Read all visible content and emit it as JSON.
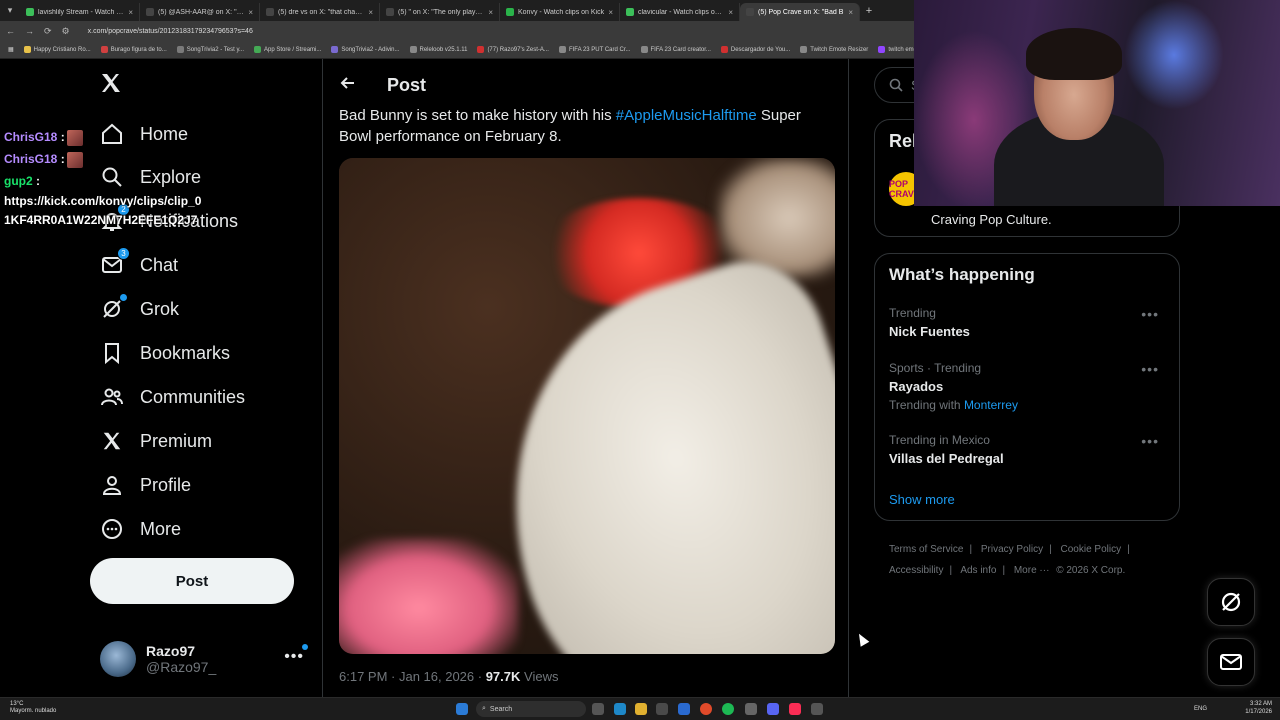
{
  "browser": {
    "tabs": [
      {
        "title": "lavishlily Stream - Watch Live o",
        "color": "#3cbf5a",
        "active": false
      },
      {
        "title": "(5) @ASH-AAR@ on X: \"Demo",
        "color": "#444444",
        "active": false
      },
      {
        "title": "(5) dre vs on X: \"that charlie ki",
        "color": "#444444",
        "active": false
      },
      {
        "title": "(5) \" on X: \"The only player to",
        "color": "#444444",
        "active": false
      },
      {
        "title": "Konvy - Watch clips on Kick",
        "color": "#2ab34a",
        "active": false
      },
      {
        "title": "clavicular - Watch clips on Kick",
        "color": "#3cbf5a",
        "active": false
      },
      {
        "title": "(5) Pop Crave on X: \"Bad B",
        "color": "#444444",
        "active": true
      }
    ],
    "url": "x.com/popcrave/status/2012318317923479653?s=46",
    "bookmarks": [
      {
        "label": "Happy Cristiano Ro...",
        "color": "#e8c24a"
      },
      {
        "label": "Burago figura de to...",
        "color": "#d04040"
      },
      {
        "label": "SongTrivia2 - Test y...",
        "color": "#7a7a7a"
      },
      {
        "label": "App Store / Streami...",
        "color": "#44aa55"
      },
      {
        "label": "SongTrivia2 - Adivin...",
        "color": "#7a6ad0"
      },
      {
        "label": "Releloob v25.1.11",
        "color": "#888888"
      },
      {
        "label": "(77) Razo97's Zest-A...",
        "color": "#d03030"
      },
      {
        "label": "FIFA 23 PUT Card Cr...",
        "color": "#888888"
      },
      {
        "label": "FIFA 23 Card creator...",
        "color": "#888888"
      },
      {
        "label": "Descargador de You...",
        "color": "#d03030"
      },
      {
        "label": "Twitch Emote Resizer",
        "color": "#888888"
      },
      {
        "label": "twitch emote w",
        "color": "#9146ff"
      }
    ]
  },
  "chat": {
    "lines": [
      {
        "user": "ChrisG18",
        "text": ":",
        "emote": true,
        "color": "#b58cff"
      },
      {
        "user": "ChrisG18",
        "text": ":",
        "emote": true,
        "color": "#b58cff"
      },
      {
        "user": "gup2",
        "text": ":",
        "emote": false,
        "color": "#19e36a"
      }
    ],
    "link_line1": "https://kick.com/konvy/clips/clip_0",
    "link_line2": "1KF4RR0A1W22NM7H2EFE1Q2J7"
  },
  "sidebar": {
    "items": [
      {
        "label": "Home",
        "icon": "home-icon"
      },
      {
        "label": "Explore",
        "icon": "search-icon"
      },
      {
        "label": "Notifications",
        "icon": "bell-icon",
        "badge": "2"
      },
      {
        "label": "Chat",
        "icon": "mail-icon",
        "badge": "3"
      },
      {
        "label": "Grok",
        "icon": "grok-icon",
        "dot": true
      },
      {
        "label": "Bookmarks",
        "icon": "bookmark-icon"
      },
      {
        "label": "Communities",
        "icon": "people-icon"
      },
      {
        "label": "Premium",
        "icon": "x-icon"
      },
      {
        "label": "Profile",
        "icon": "person-icon"
      },
      {
        "label": "More",
        "icon": "more-circle-icon"
      }
    ],
    "post_button": "Post",
    "account": {
      "name": "Razo97",
      "handle": "@Razo97_"
    }
  },
  "main": {
    "title": "Post",
    "text_before": "Bad Bunny is set to make history with his ",
    "hashtag": "#AppleMusicHalftime",
    "text_after": " Super Bowl performance on February 8.",
    "time": "6:17 PM · Jan 16, 2026 · ",
    "views_count": "97.7K",
    "views_label": " Views"
  },
  "right": {
    "search_placeholder": "Se",
    "relevant_title": "Rel",
    "relevant_logo": "POP CRAVE",
    "relevant_bio": "Craving Pop Culture.",
    "happening_title": "What’s happening",
    "trends": [
      {
        "context": "Trending",
        "name": "Nick Fuentes",
        "with": ""
      },
      {
        "context": "Sports · Trending",
        "name": "Rayados",
        "with": "Monterrey"
      },
      {
        "context": "Trending in Mexico",
        "name": "Villas del Pedregal",
        "with": ""
      }
    ],
    "trending_with_label": "Trending with ",
    "show_more": "Show more",
    "footer": {
      "terms": "Terms of Service",
      "privacy": "Privacy Policy",
      "cookie": "Cookie Policy",
      "accessibility": "Accessibility",
      "ads": "Ads info",
      "more": "More ···",
      "copyright": "© 2026 X Corp."
    }
  },
  "taskbar": {
    "temp": "13°C",
    "weather": "Mayorm. nublado",
    "search": "Search",
    "lang": "ENG",
    "time": "3:32 AM",
    "date": "1/17/2026"
  },
  "colors": {
    "accent": "#1d9bf0",
    "background": "#000000",
    "text": "#e7e9ea",
    "muted": "#71767b",
    "border": "#2f3336"
  }
}
